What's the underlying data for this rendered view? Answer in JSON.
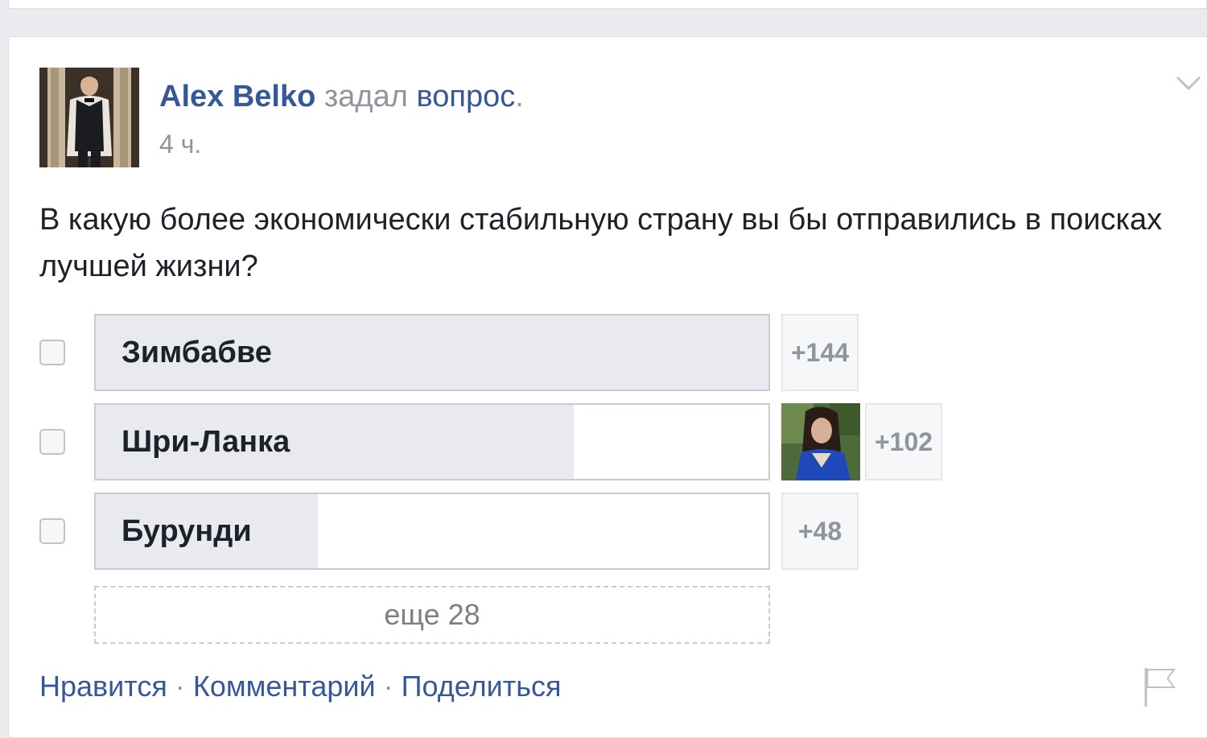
{
  "post": {
    "author": "Alex Belko",
    "action_word1": "задал",
    "action_word2": "вопрос",
    "action_dot": ".",
    "time": "4 ч.",
    "question": "В какую более экономически стабильную страну вы бы отправились в поисках лучшей жизни?"
  },
  "poll": {
    "options": [
      {
        "label": "Зимбабве",
        "count": "+144",
        "fill": 1.0
      },
      {
        "label": "Шри-Ланка",
        "count": "+102",
        "fill": 0.71
      },
      {
        "label": "Бурунди",
        "count": "+48",
        "fill": 0.33
      }
    ],
    "more": "еще 28"
  },
  "actions": {
    "like": "Нравится",
    "comment": "Комментарий",
    "share": "Поделиться",
    "separator": "·"
  },
  "icons": {
    "menu": "chevron-down-icon",
    "report": "flag-icon"
  },
  "colors": {
    "link": "#365899",
    "muted": "#90949c",
    "bar_fill": "#e9eaef"
  }
}
